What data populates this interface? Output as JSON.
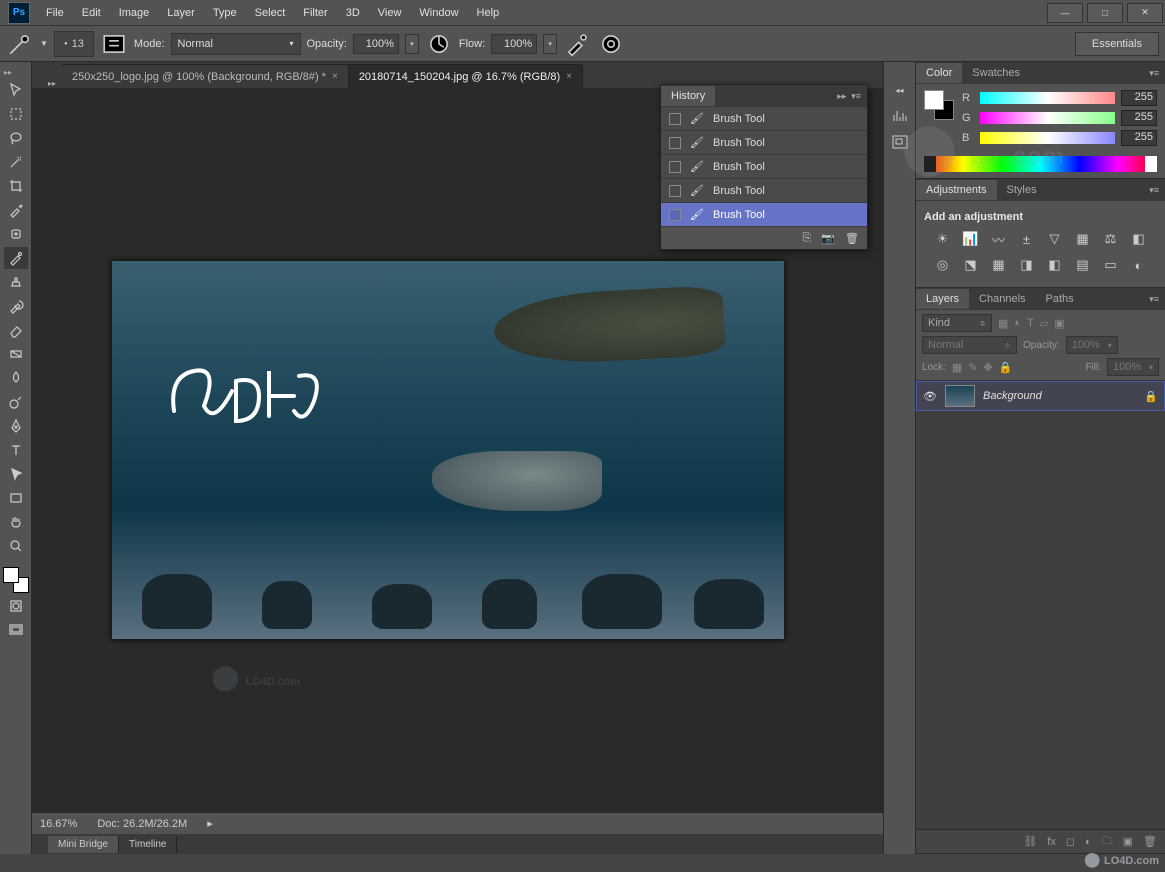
{
  "app": {
    "logo": "Ps"
  },
  "menus": [
    "File",
    "Edit",
    "Image",
    "Layer",
    "Type",
    "Select",
    "Filter",
    "3D",
    "View",
    "Window",
    "Help"
  ],
  "window_controls": {
    "min": "—",
    "max": "□",
    "close": "✕"
  },
  "options": {
    "brush_size": "13",
    "mode_label": "Mode:",
    "mode_value": "Normal",
    "opacity_label": "Opacity:",
    "opacity_value": "100%",
    "flow_label": "Flow:",
    "flow_value": "100%",
    "workspace_button": "Essentials"
  },
  "doc_tabs": [
    {
      "label": "250x250_logo.jpg @ 100% (Background, RGB/8#) *",
      "active": false
    },
    {
      "label": "20180714_150204.jpg @ 16.7% (RGB/8)",
      "active": true
    }
  ],
  "tools": [
    "move",
    "marquee",
    "lasso",
    "wand",
    "crop",
    "eyedropper",
    "healing",
    "brush",
    "stamp",
    "history-brush",
    "eraser",
    "gradient",
    "blur",
    "dodge",
    "pen",
    "type",
    "path-select",
    "rectangle",
    "hand",
    "zoom"
  ],
  "canvas_annotation": "Lo4D",
  "status": {
    "zoom": "16.67%",
    "doc_info": "Doc: 26.2M/26.2M"
  },
  "bottom_tabs": [
    "Mini Bridge",
    "Timeline"
  ],
  "history": {
    "title": "History",
    "items": [
      "Brush Tool",
      "Brush Tool",
      "Brush Tool",
      "Brush Tool",
      "Brush Tool"
    ],
    "selected_index": 4
  },
  "right": {
    "color": {
      "tabs": [
        "Color",
        "Swatches"
      ],
      "channels": [
        {
          "label": "R",
          "value": "255"
        },
        {
          "label": "G",
          "value": "255"
        },
        {
          "label": "B",
          "value": "255"
        }
      ]
    },
    "adjustments": {
      "tabs": [
        "Adjustments",
        "Styles"
      ],
      "heading": "Add an adjustment"
    },
    "layers": {
      "tabs": [
        "Layers",
        "Channels",
        "Paths"
      ],
      "kind_label": "Kind",
      "blend_mode": "Normal",
      "opacity_label": "Opacity:",
      "opacity_value": "100%",
      "lock_label": "Lock:",
      "fill_label": "Fill:",
      "fill_value": "100%",
      "items": [
        {
          "name": "Background",
          "locked": true
        }
      ]
    }
  },
  "watermark": {
    "text": "LO4D",
    "domain": ".com"
  }
}
